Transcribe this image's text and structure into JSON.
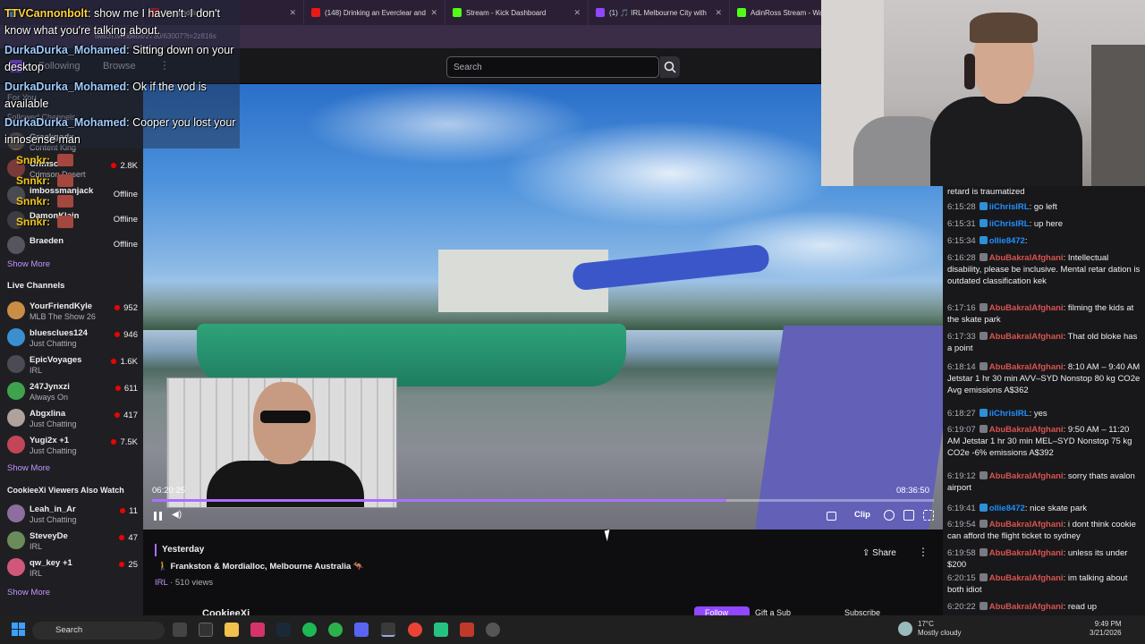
{
  "browser": {
    "tabs": [
      {
        "label": "Trapped In Toky",
        "color": "#e91916"
      },
      {
        "label": "(148) Drinking an Everclear and",
        "color": "#e91916"
      },
      {
        "label": "Stream - Kick Dashboard",
        "color": "#53fc18"
      },
      {
        "label": "(1) 🎵 IRL Melbourne City with",
        "color": "#9147ff"
      },
      {
        "label": "AdinRoss Stream - Wa",
        "color": "#53fc18"
      }
    ],
    "url": "twitch.tv/videos/2730/63007?t=2z816s"
  },
  "topnav": {
    "following": "Following",
    "browse": "Browse",
    "more": "⋮",
    "search_placeholder": "Search"
  },
  "sidebar": {
    "for_you": "For You",
    "followed_heading": "Followed Channels",
    "followed": [
      {
        "name": "Greekgodx",
        "game": "Content King",
        "viewers": "",
        "status": ""
      },
      {
        "name": "Crimson",
        "game": "Crimson Desert",
        "viewers": "2.8K",
        "status": ""
      },
      {
        "name": "imbossmanjack",
        "game": "",
        "viewers": "",
        "status": "Offline"
      },
      {
        "name": "DamonKlain",
        "game": "",
        "viewers": "",
        "status": "Offline"
      },
      {
        "name": "Braeden",
        "game": "",
        "viewers": "",
        "status": "Offline"
      }
    ],
    "show_more_1": "Show More",
    "live_heading": "Live Channels",
    "live": [
      {
        "name": "YourFriendKyle",
        "game": "MLB The Show 26",
        "viewers": "952",
        "color": "#c98d45"
      },
      {
        "name": "bluesclues124",
        "game": "Just Chatting",
        "viewers": "946",
        "color": "#3a8fd0"
      },
      {
        "name": "EpicVoyages",
        "game": "IRL",
        "viewers": "1.6K",
        "color": "#4b4b55"
      },
      {
        "name": "247Jynxzi",
        "game": "Always On",
        "viewers": "611",
        "color": "#3fa34d"
      },
      {
        "name": "Abgxlina",
        "game": "Just Chatting",
        "viewers": "417",
        "color": "#b0a29a"
      },
      {
        "name": "Yugi2x +1",
        "game": "Just Chatting",
        "viewers": "7.5K",
        "color": "#c2455a"
      }
    ],
    "show_more_2": "Show More",
    "also_watch_heading": "CookieeXi Viewers Also Watch",
    "also_watch": [
      {
        "name": "Leah_in_Ar",
        "game": "Just Chatting",
        "viewers": "11",
        "color": "#8e6e9e"
      },
      {
        "name": "SteveyDe",
        "game": "IRL",
        "viewers": "47",
        "color": "#6b8c5a"
      },
      {
        "name": "qw_key +1",
        "game": "IRL",
        "viewers": "25",
        "color": "#d0577a"
      }
    ],
    "show_more_3": "Show More"
  },
  "overlay_chat": [
    {
      "user": "TTVCannonbolt",
      "text": "show me I haven't. I don't know what you're talking about.",
      "color": "#ffd43b"
    },
    {
      "user": "DurkaDurka_Mohamed",
      "text": "Sitting down on your desktop",
      "color": "#9ecbff"
    },
    {
      "user": "DurkaDurka_Mohamed",
      "text": "Ok if the vod is available",
      "color": "#9ecbff"
    },
    {
      "user": "DurkaDurka_Mohamed",
      "text": "Cooper you lost your innosense man",
      "color": "#9ecbff"
    }
  ],
  "overlay_snnkr": "Snnkr:",
  "player": {
    "current_time": "06:20:25",
    "total_time": "08:36:50",
    "progress": 0.734,
    "clip_label": "Clip"
  },
  "video_info": {
    "date": "Yesterday",
    "title": "🚶 Frankston & Mordialloc, Melbourne Australia 🦘",
    "category": "IRL",
    "views": " · 510 views",
    "share_label": "Share",
    "channel": "CookieeXi",
    "follow_label": "Follow",
    "gift_label": "Gift a Sub",
    "subscribe_label": "Subscribe"
  },
  "chat": [
    {
      "ts": "",
      "user": "",
      "text": "retard is traumatized",
      "color": "#efeff1"
    },
    {
      "ts": "6:15:28",
      "user": "iiChrisIRL",
      "text": ": go left",
      "color": "#1e90ff"
    },
    {
      "ts": "6:15:31",
      "user": "iiChrisIRL",
      "text": ": up here",
      "color": "#1e90ff"
    },
    {
      "ts": "6:15:34",
      "user": "ollie8472",
      "text": ":",
      "color": "#1e90ff"
    },
    {
      "ts": "6:16:28",
      "user": "AbuBakralAfghani",
      "text": ": Intellectual disability, please be inclusive. Mental retar dation is outdated classification kek",
      "color": "#d9534f"
    },
    {
      "ts": "6:17:16",
      "user": "AbuBakralAfghani",
      "text": ": filming the kids at the skate park",
      "color": "#d9534f"
    },
    {
      "ts": "6:17:33",
      "user": "AbuBakralAfghani",
      "text": ": That old bloke has a point",
      "color": "#d9534f"
    },
    {
      "ts": "6:18:14",
      "user": "AbuBakralAfghani",
      "text": ": 8:10 AM – 9:40 AM Jetstar 1 hr 30 min AVV–SYD Nonstop 80 kg CO2e Avg emissions A$362",
      "color": "#d9534f"
    },
    {
      "ts": "6:18:27",
      "user": "iiChrisIRL",
      "text": ": yes",
      "color": "#1e90ff"
    },
    {
      "ts": "6:19:07",
      "user": "AbuBakralAfghani",
      "text": ": 9:50 AM – 11:20 AM Jetstar 1 hr 30 min MEL–SYD Nonstop 75 kg CO2e -6% emissions A$392",
      "color": "#d9534f"
    },
    {
      "ts": "6:19:12",
      "user": "AbuBakralAfghani",
      "text": ": sorry thats avalon airport",
      "color": "#d9534f"
    },
    {
      "ts": "6:19:41",
      "user": "ollie8472",
      "text": ": nice skate park",
      "color": "#1e90ff"
    },
    {
      "ts": "6:19:54",
      "user": "AbuBakralAfghani",
      "text": ": i dont think cookie can afford the flight ticket to sydney",
      "color": "#d9534f"
    },
    {
      "ts": "6:19:58",
      "user": "AbuBakralAfghani",
      "text": ": unless its under $200",
      "color": "#d9534f"
    },
    {
      "ts": "6:20:15",
      "user": "AbuBakralAfghani",
      "text": ": im talking about both idiot",
      "color": "#d9534f"
    },
    {
      "ts": "6:20:22",
      "user": "AbuBakralAfghani",
      "text": ": read up",
      "color": "#d9534f"
    }
  ],
  "taskbar": {
    "search_label": "Search",
    "weather_temp": "17°C",
    "weather_desc": "Mostly cloudy",
    "time": "9:49 PM",
    "date": "3/21/2026"
  }
}
